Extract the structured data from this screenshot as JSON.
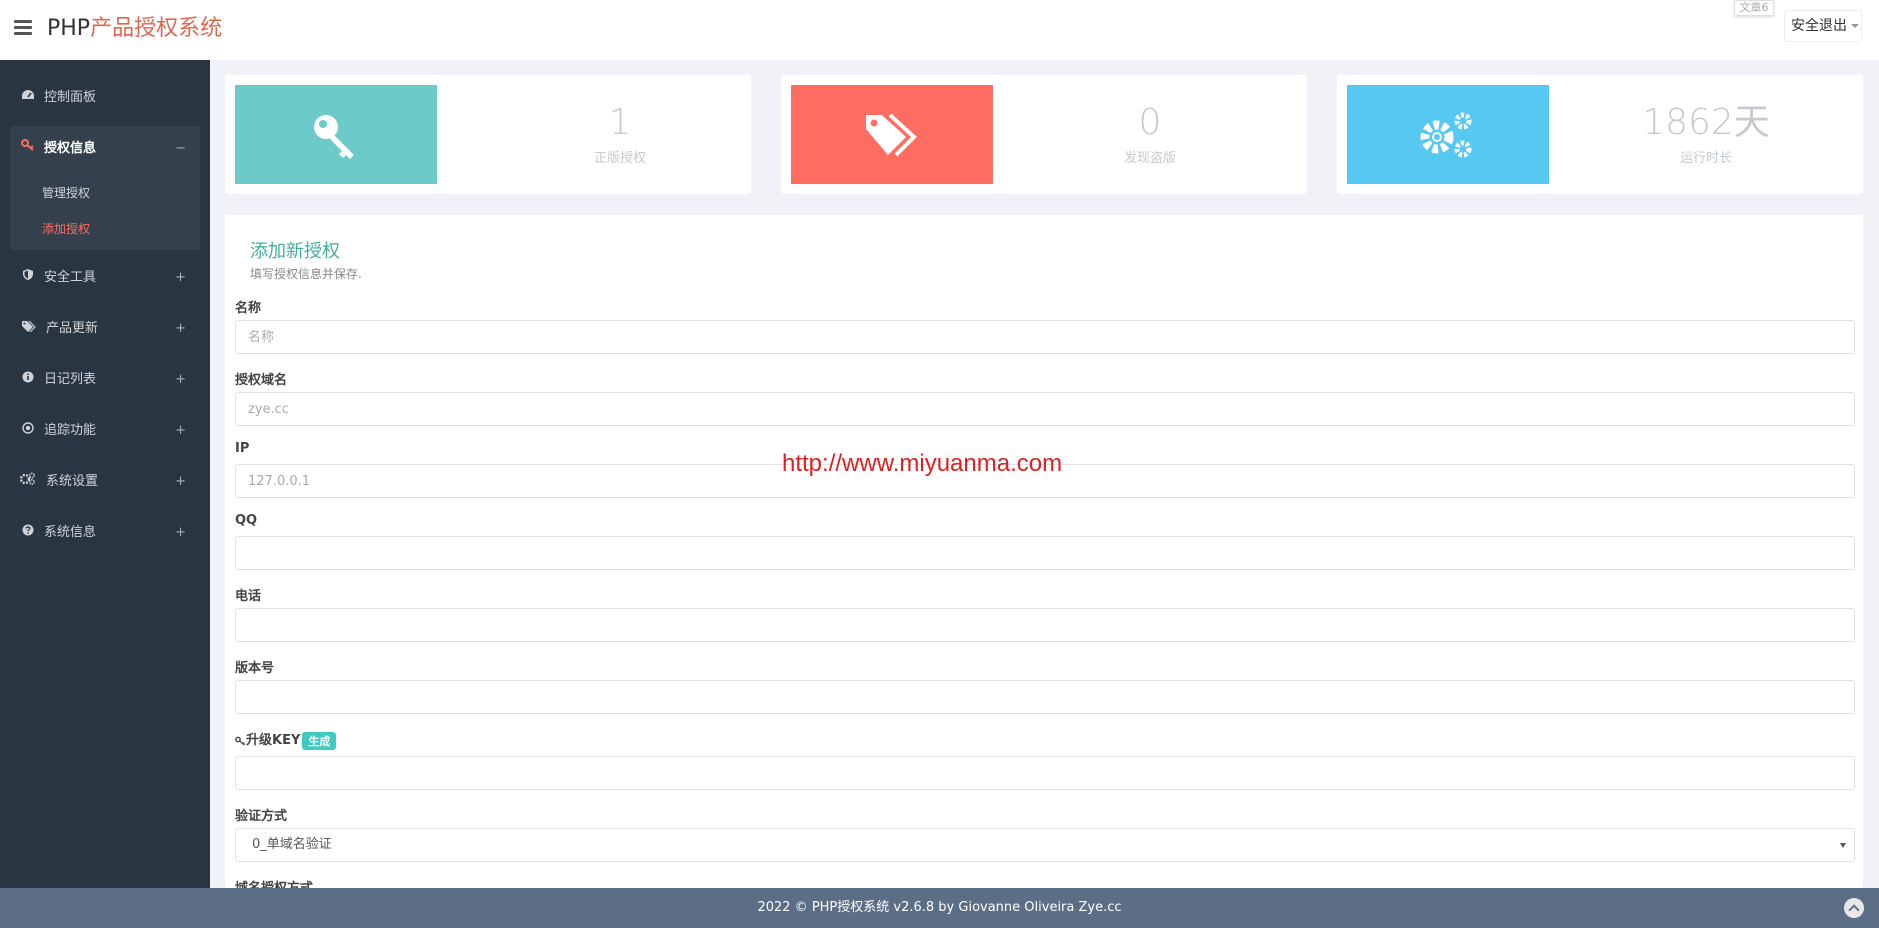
{
  "header": {
    "brand_prefix": "PHP",
    "brand_suffix": "产品授权系统",
    "top_tag": "文章6",
    "logout_label": "安全退出"
  },
  "sidebar": {
    "dashboard": {
      "label": "控制面板",
      "icon": "dashboard-icon"
    },
    "auth_info": {
      "label": "授权信息",
      "icon": "key-icon",
      "toggle": "−",
      "children": [
        {
          "label": "管理授权",
          "active": false
        },
        {
          "label": "添加授权",
          "active": true
        }
      ]
    },
    "items": [
      {
        "label": "安全工具",
        "icon": "shield-icon",
        "toggle": "+"
      },
      {
        "label": "产品更新",
        "icon": "tags-icon",
        "toggle": "+"
      },
      {
        "label": "日记列表",
        "icon": "info-icon",
        "toggle": "+"
      },
      {
        "label": "追踪功能",
        "icon": "target-icon",
        "toggle": "+"
      },
      {
        "label": "系统设置",
        "icon": "gears-icon",
        "toggle": "+"
      },
      {
        "label": "系统信息",
        "icon": "question-icon",
        "toggle": "+"
      }
    ]
  },
  "stats": [
    {
      "value": "1",
      "caption": "正版授权",
      "color": "#6ccac9",
      "icon": "key-icon"
    },
    {
      "value": "0",
      "caption": "发现盗版",
      "color": "#ff6c60",
      "icon": "tags-icon"
    },
    {
      "value": "1862天",
      "caption": "运行时长",
      "color": "#57c8f2",
      "icon": "gears-icon"
    }
  ],
  "form": {
    "title": "添加新授权",
    "subtitle": "填写授权信息并保存.",
    "fields": {
      "name": {
        "label": "名称",
        "placeholder": "名称",
        "value": ""
      },
      "domain": {
        "label": "授权域名",
        "placeholder": "zye.cc",
        "value": ""
      },
      "ip": {
        "label": "IP",
        "placeholder": "127.0.0.1",
        "value": ""
      },
      "qq": {
        "label": "QQ",
        "placeholder": "",
        "value": ""
      },
      "phone": {
        "label": "电话",
        "placeholder": "",
        "value": ""
      },
      "version": {
        "label": "版本号",
        "placeholder": "",
        "value": ""
      },
      "upgrade_key": {
        "label": "升级KEY",
        "button": "生成",
        "value": ""
      },
      "verify_method": {
        "label": "验证方式",
        "selected": "0_单域名验证"
      },
      "domain_auth_method": {
        "label": "域名授权方式"
      }
    }
  },
  "watermark": "http://www.miyuanma.com",
  "footer": {
    "text": "2022 © PHP授权系统 v2.6.8 by Giovanne Oliveira Zye.cc"
  }
}
